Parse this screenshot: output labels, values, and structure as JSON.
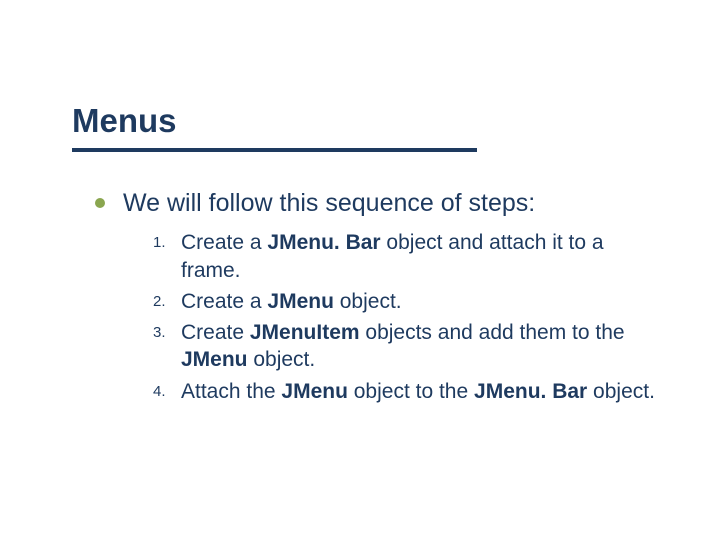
{
  "title": "Menus",
  "lead": "We will follow this sequence of steps:",
  "steps": [
    {
      "num": "1.",
      "parts": [
        {
          "t": "Create a "
        },
        {
          "t": "JMenu. Bar",
          "b": true
        },
        {
          "t": " object and attach it to a frame."
        }
      ]
    },
    {
      "num": "2.",
      "parts": [
        {
          "t": "Create a "
        },
        {
          "t": "JMenu",
          "b": true
        },
        {
          "t": " object."
        }
      ]
    },
    {
      "num": "3.",
      "parts": [
        {
          "t": "Create "
        },
        {
          "t": "JMenuItem",
          "b": true
        },
        {
          "t": " objects and add them to the "
        },
        {
          "t": "JMenu",
          "b": true
        },
        {
          "t": " object."
        }
      ]
    },
    {
      "num": "4.",
      "parts": [
        {
          "t": "Attach the "
        },
        {
          "t": "JMenu",
          "b": true
        },
        {
          "t": " object to the "
        },
        {
          "t": "JMenu. Bar",
          "b": true
        },
        {
          "t": " object."
        }
      ]
    }
  ]
}
